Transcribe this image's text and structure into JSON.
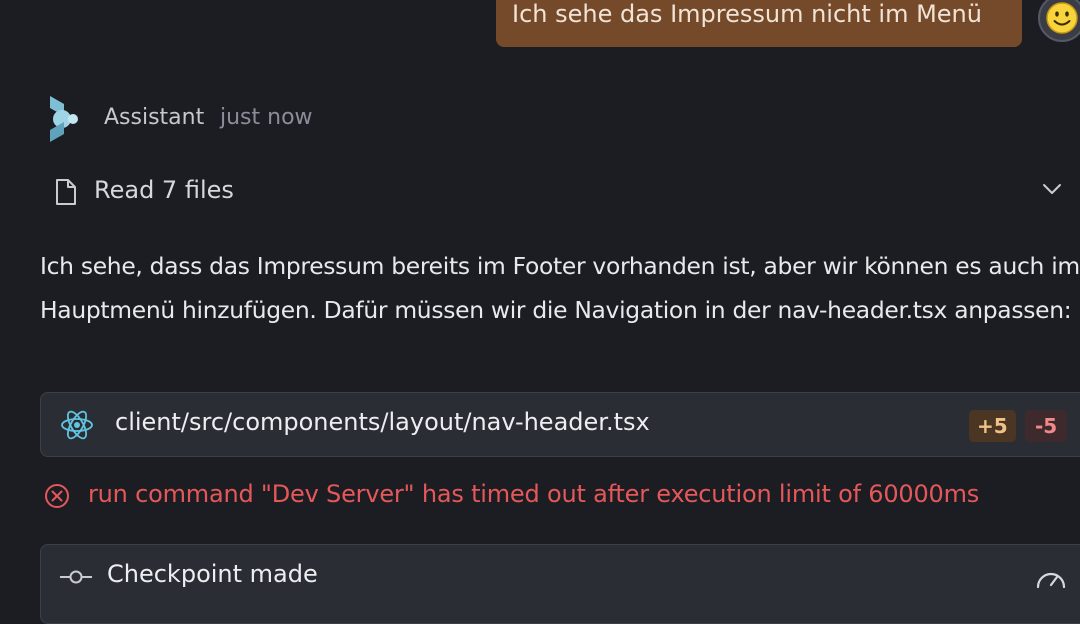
{
  "user_message": {
    "text": "Ich sehe das Impressum nicht im Menü"
  },
  "assistant": {
    "name": "Assistant",
    "timestamp": "just now"
  },
  "files_read": {
    "label": "Read 7 files"
  },
  "message": {
    "text": "Ich sehe, dass das Impressum bereits im Footer vorhanden ist, aber wir können es auch im Hauptmenü hinzufügen. Dafür müssen wir die Navigation in der nav-header.tsx anpassen:"
  },
  "file_change": {
    "path": "client/src/components/layout/nav-header.tsx",
    "additions": "+5",
    "deletions": "-5"
  },
  "error": {
    "text": "run command \"Dev Server\" has timed out after execution limit of 60000ms"
  },
  "checkpoint": {
    "label": "Checkpoint made"
  },
  "colors": {
    "background": "#1c1d23",
    "user_bubble": "#754a2a",
    "card": "#2b2d35",
    "error": "#e5585a",
    "react_blue": "#61c4e0"
  },
  "icons": [
    "smiley-avatar-icon",
    "assistant-logo-icon",
    "file-icon",
    "chevron-down-icon",
    "react-icon",
    "error-circle-icon",
    "commit-icon",
    "gauge-icon"
  ]
}
